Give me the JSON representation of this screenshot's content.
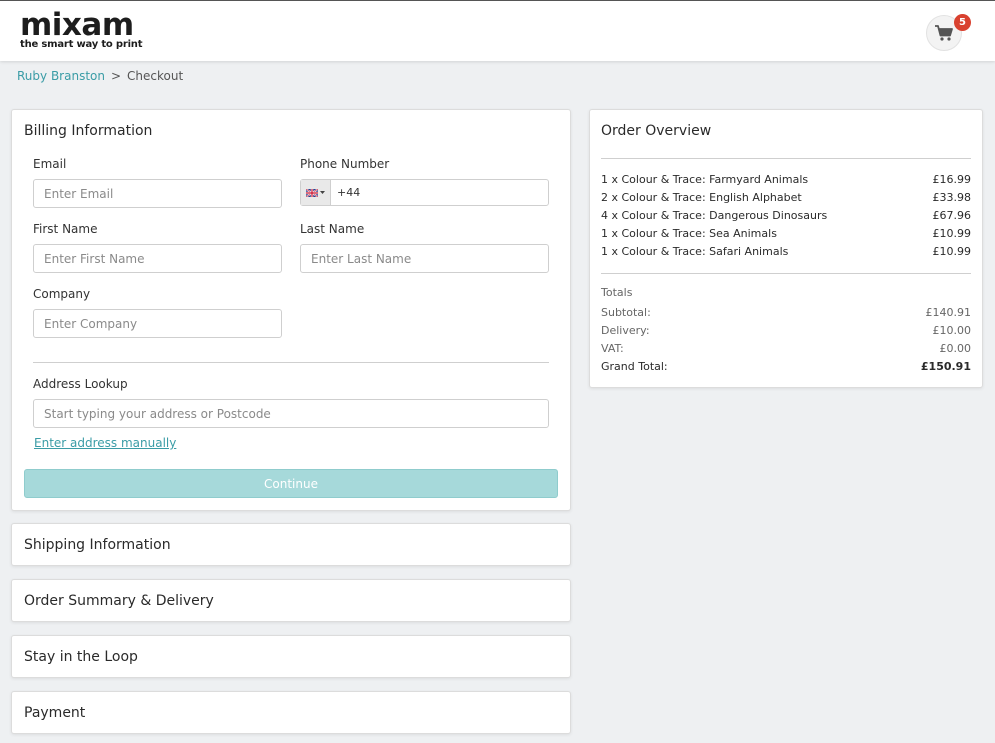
{
  "header": {
    "logo_text": "mixam",
    "logo_tagline": "the smart way to print",
    "cart_count": "5"
  },
  "breadcrumb": {
    "user": "Ruby Branston",
    "separator": ">",
    "current": "Checkout"
  },
  "billing": {
    "title": "Billing Information",
    "email_label": "Email",
    "email_placeholder": "Enter Email",
    "phone_label": "Phone Number",
    "phone_value": "+44",
    "first_name_label": "First Name",
    "first_name_placeholder": "Enter First Name",
    "last_name_label": "Last Name",
    "last_name_placeholder": "Enter Last Name",
    "company_label": "Company",
    "company_placeholder": "Enter Company",
    "address_label": "Address Lookup",
    "address_placeholder": "Start typing your address or Postcode",
    "manual_link": "Enter address manually",
    "continue_label": "Continue"
  },
  "sections": {
    "shipping": "Shipping Information",
    "order_summary": "Order Summary & Delivery",
    "loop": "Stay in the Loop",
    "payment": "Payment"
  },
  "overview": {
    "title": "Order Overview",
    "items": [
      {
        "name": "1 x Colour & Trace: Farmyard Animals",
        "price": "£16.99"
      },
      {
        "name": "2 x Colour & Trace: English Alphabet",
        "price": "£33.98"
      },
      {
        "name": "4 x Colour & Trace: Dangerous Dinosaurs",
        "price": "£67.96"
      },
      {
        "name": "1 x Colour & Trace: Sea Animals",
        "price": "£10.99"
      },
      {
        "name": "1 x Colour & Trace: Safari Animals",
        "price": "£10.99"
      }
    ],
    "totals_label": "Totals",
    "subtotal_label": "Subtotal:",
    "subtotal": "£140.91",
    "delivery_label": "Delivery:",
    "delivery": "£10.00",
    "vat_label": "VAT:",
    "vat": "£0.00",
    "grand_total_label": "Grand Total:",
    "grand_total": "£150.91"
  },
  "colors": {
    "accent": "#3a9ca6",
    "continue_bg": "#a6d9da",
    "badge": "#d9412f"
  },
  "icons": {
    "cart": "shopping-cart-icon",
    "flag": "uk-flag-icon"
  }
}
